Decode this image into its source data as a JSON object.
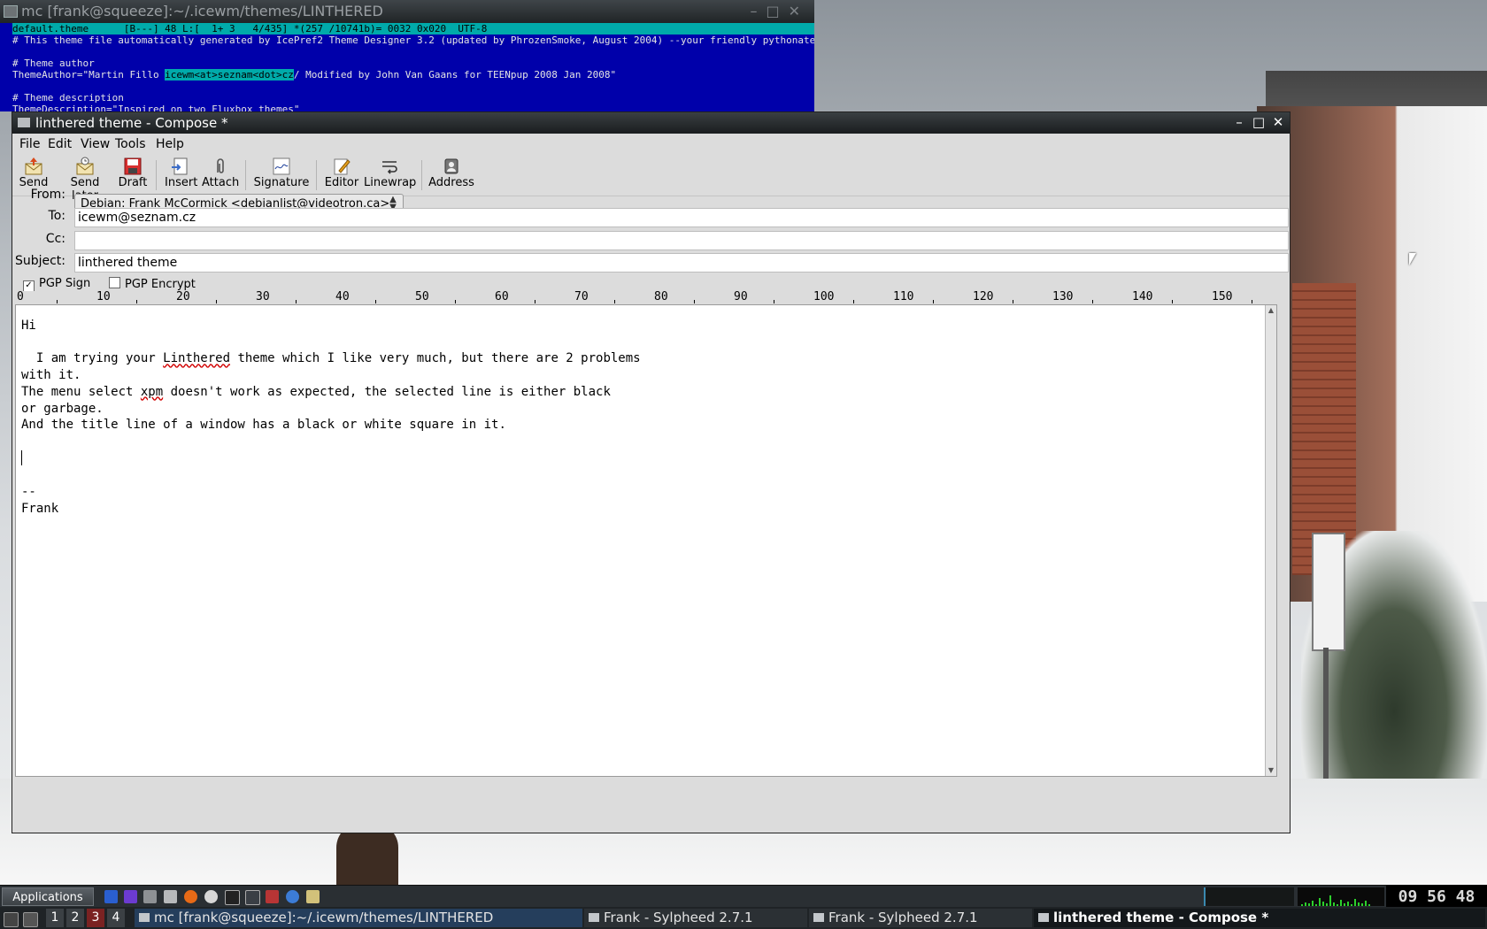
{
  "terminal": {
    "title": "mc [frank@squeeze]:~/.icewm/themes/LINTHERED",
    "status_line": "default.theme      [B---] 48 L:[  1+ 3   4/435] *(257 /10741b)= 0032 0x020  UTF-8",
    "lines": [
      "# This theme file automatically generated by IcePref2 Theme Designer 3.2 (updated by PhrozenSmoke, August 2004) --your friendly pythonated config util",
      "",
      "# Theme author"
    ],
    "author_prefix": "ThemeAuthor=\"Martin Fillo ",
    "author_highlight": "icewm<at>seznam<dot>cz",
    "author_suffix": "/ Modified by John Van Gaans for TEENpup 2008 Jan 2008\"",
    "desc_line1": "",
    "desc_line2": "# Theme description",
    "desc_line3": "ThemeDescription=\"Inspired on two Fluxbox themes\""
  },
  "compose": {
    "title": "linthered theme - Compose *",
    "menu": [
      "File",
      "Edit",
      "View",
      "Tools",
      "Help"
    ],
    "toolbar": {
      "send": "Send",
      "send_later": "Send later",
      "draft": "Draft",
      "insert": "Insert",
      "attach": "Attach",
      "signature": "Signature",
      "editor": "Editor",
      "linewrap": "Linewrap",
      "address": "Address"
    },
    "headers": {
      "from_label": "From:",
      "from_value": "Debian: Frank McCormick <debianlist@videotron.ca>",
      "to_label": "To:",
      "to_value": "icewm@seznam.cz",
      "cc_label": "Cc:",
      "cc_value": "",
      "subject_label": "Subject:",
      "subject_value": "linthered theme"
    },
    "options": {
      "pgp_sign_label": "PGP Sign",
      "pgp_sign_checked": true,
      "pgp_encrypt_label": "PGP Encrypt",
      "pgp_encrypt_checked": false
    },
    "ruler_ticks": [
      "0",
      "10",
      "20",
      "30",
      "40",
      "50",
      "60",
      "70",
      "80",
      "90",
      "100",
      "110",
      "120",
      "130",
      "140",
      "150"
    ],
    "body": {
      "l1": "Hi",
      "l2": "",
      "l3a": "  I am trying your ",
      "l3b": "Linthered",
      "l3c": " theme which I like very much, but there are 2 problems",
      "l4": "with it.",
      "l5a": "The menu select ",
      "l5b": "xpm",
      "l5c": " doesn't work as expected, the selected line is either black",
      "l6": "or garbage.",
      "l7": "And the title line of a window has a black or white square in it.",
      "sig_sep": "--",
      "sig_name": "Frank"
    }
  },
  "taskbar": {
    "applications": "Applications",
    "workspaces": [
      "1",
      "2",
      "3",
      "4"
    ],
    "tasks": [
      "mc [frank@squeeze]:~/.icewm/themes/LINTHERED",
      "Frank - Sylpheed 2.7.1",
      "Frank - Sylpheed 2.7.1",
      "linthered theme - Compose *"
    ],
    "clock": "09 56 48"
  },
  "colors": {
    "terminal_bg": "#0000aa",
    "terminal_hl": "#00aaaa",
    "titlebar": "#1a1d1f",
    "window_bg": "#dcdcdc",
    "spell_error": "#d10000"
  }
}
